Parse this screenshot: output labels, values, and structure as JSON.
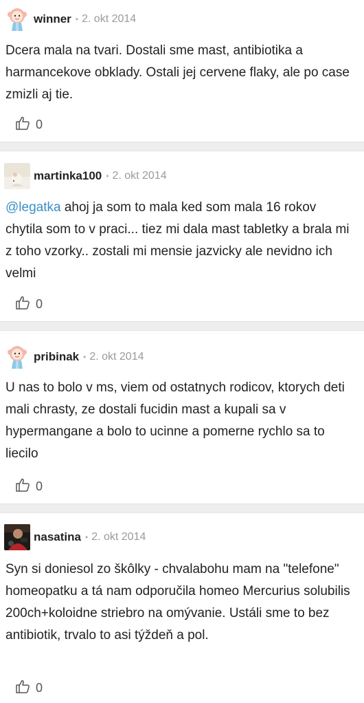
{
  "comments": [
    {
      "username": "winner",
      "date": "2. okt 2014",
      "separator": "•",
      "avatar_icon": "girl-avatar-icon",
      "text": "Dcera mala na tvari. Dostali sme mast, antibiotika a harmancekove obklady. Ostali jej cervene flaky, ale po case zmizli aj tie.",
      "likes": "0"
    },
    {
      "username": "martinka100",
      "date": "2. okt 2014",
      "separator": "•",
      "avatar_icon": "photo-avatar-icon",
      "mention": "@legatka",
      "text": " ahoj ja som to mala ked som mala 16 rokov chytila som to v praci... tiez mi dala mast tabletky a brala mi z toho vzorky.. zostali mi mensie jazvicky ale nevidno ich velmi",
      "likes": "0"
    },
    {
      "username": "pribinak",
      "date": "2. okt 2014",
      "separator": "•",
      "avatar_icon": "girl-avatar-icon",
      "text": "U nas to bolo v ms, viem od ostatnych rodicov, ktorych deti mali chrasty, ze dostali fucidin mast a kupali sa v hypermangane a bolo to ucinne a pomerne rychlo sa to liecilo",
      "likes": "0"
    },
    {
      "username": "nasatina",
      "date": "2. okt 2014",
      "separator": "•",
      "avatar_icon": "photo-avatar-icon",
      "text": "Syn si doniesol zo škôlky - chvalabohu mam na \"telefone\" homeopatku a tá nam odporučila homeo Mercurius solubilis 200ch+koloidne striebro na omývanie. Ustáli sme to bez antibiotik, trvalo to asi týždeň a pol.",
      "likes": "0"
    }
  ],
  "colors": {
    "mention": "#3a8fc7",
    "date": "#9a9a9a",
    "divider": "#eeeeee"
  },
  "like_icon": "thumbs-up-icon"
}
